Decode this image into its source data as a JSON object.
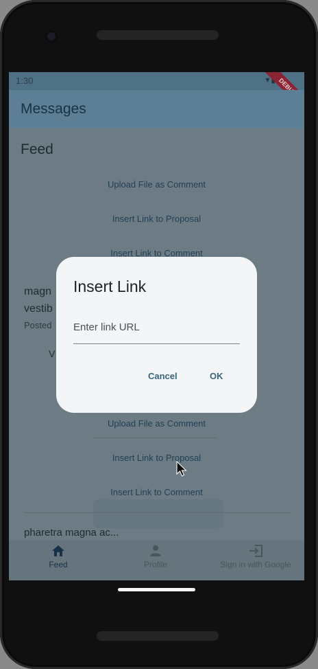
{
  "status_bar": {
    "time": "1:30",
    "icons": "▾▮",
    "debug": "DEBUG"
  },
  "app_bar": {
    "title": "Messages"
  },
  "feed": {
    "heading": "Feed",
    "actions_top": [
      "Upload File as Comment",
      "Insert Link to Proposal",
      "Insert Link to Comment"
    ],
    "post_partial": {
      "line1": "magn",
      "line2": "vestib",
      "posted": "Posted",
      "v": "V"
    },
    "actions_bottom": [
      "Upload File as Comment",
      "Insert Link to Proposal",
      "Insert Link to Comment"
    ],
    "next_post": "pharetra magna ac..."
  },
  "bottom_nav": {
    "items": [
      {
        "label": "Feed",
        "icon": "home-icon"
      },
      {
        "label": "Profile",
        "icon": "person-icon"
      },
      {
        "label": "Sign in with Google",
        "icon": "login-icon"
      }
    ]
  },
  "dialog": {
    "title": "Insert Link",
    "input_placeholder": "Enter link URL",
    "cancel_label": "Cancel",
    "ok_label": "OK"
  },
  "colors": {
    "accent": "#38647b",
    "appbar": "#5c7f95",
    "debug": "#8a2433"
  }
}
